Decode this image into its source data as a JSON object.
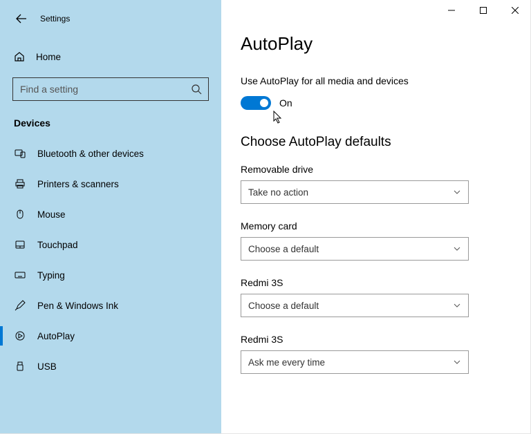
{
  "window": {
    "title": "Settings"
  },
  "sidebar": {
    "home": "Home",
    "search_placeholder": "Find a setting",
    "section": "Devices",
    "items": [
      {
        "label": "Bluetooth & other devices"
      },
      {
        "label": "Printers & scanners"
      },
      {
        "label": "Mouse"
      },
      {
        "label": "Touchpad"
      },
      {
        "label": "Typing"
      },
      {
        "label": "Pen & Windows Ink"
      },
      {
        "label": "AutoPlay"
      },
      {
        "label": "USB"
      }
    ]
  },
  "page": {
    "heading": "AutoPlay",
    "toggle_label": "Use AutoPlay for all media and devices",
    "toggle_state": "On",
    "sub_heading": "Choose AutoPlay defaults",
    "groups": [
      {
        "label": "Removable drive",
        "value": "Take no action"
      },
      {
        "label": "Memory card",
        "value": "Choose a default"
      },
      {
        "label": "Redmi 3S",
        "value": "Choose a default"
      },
      {
        "label": "Redmi 3S",
        "value": "Ask me every time"
      }
    ]
  }
}
